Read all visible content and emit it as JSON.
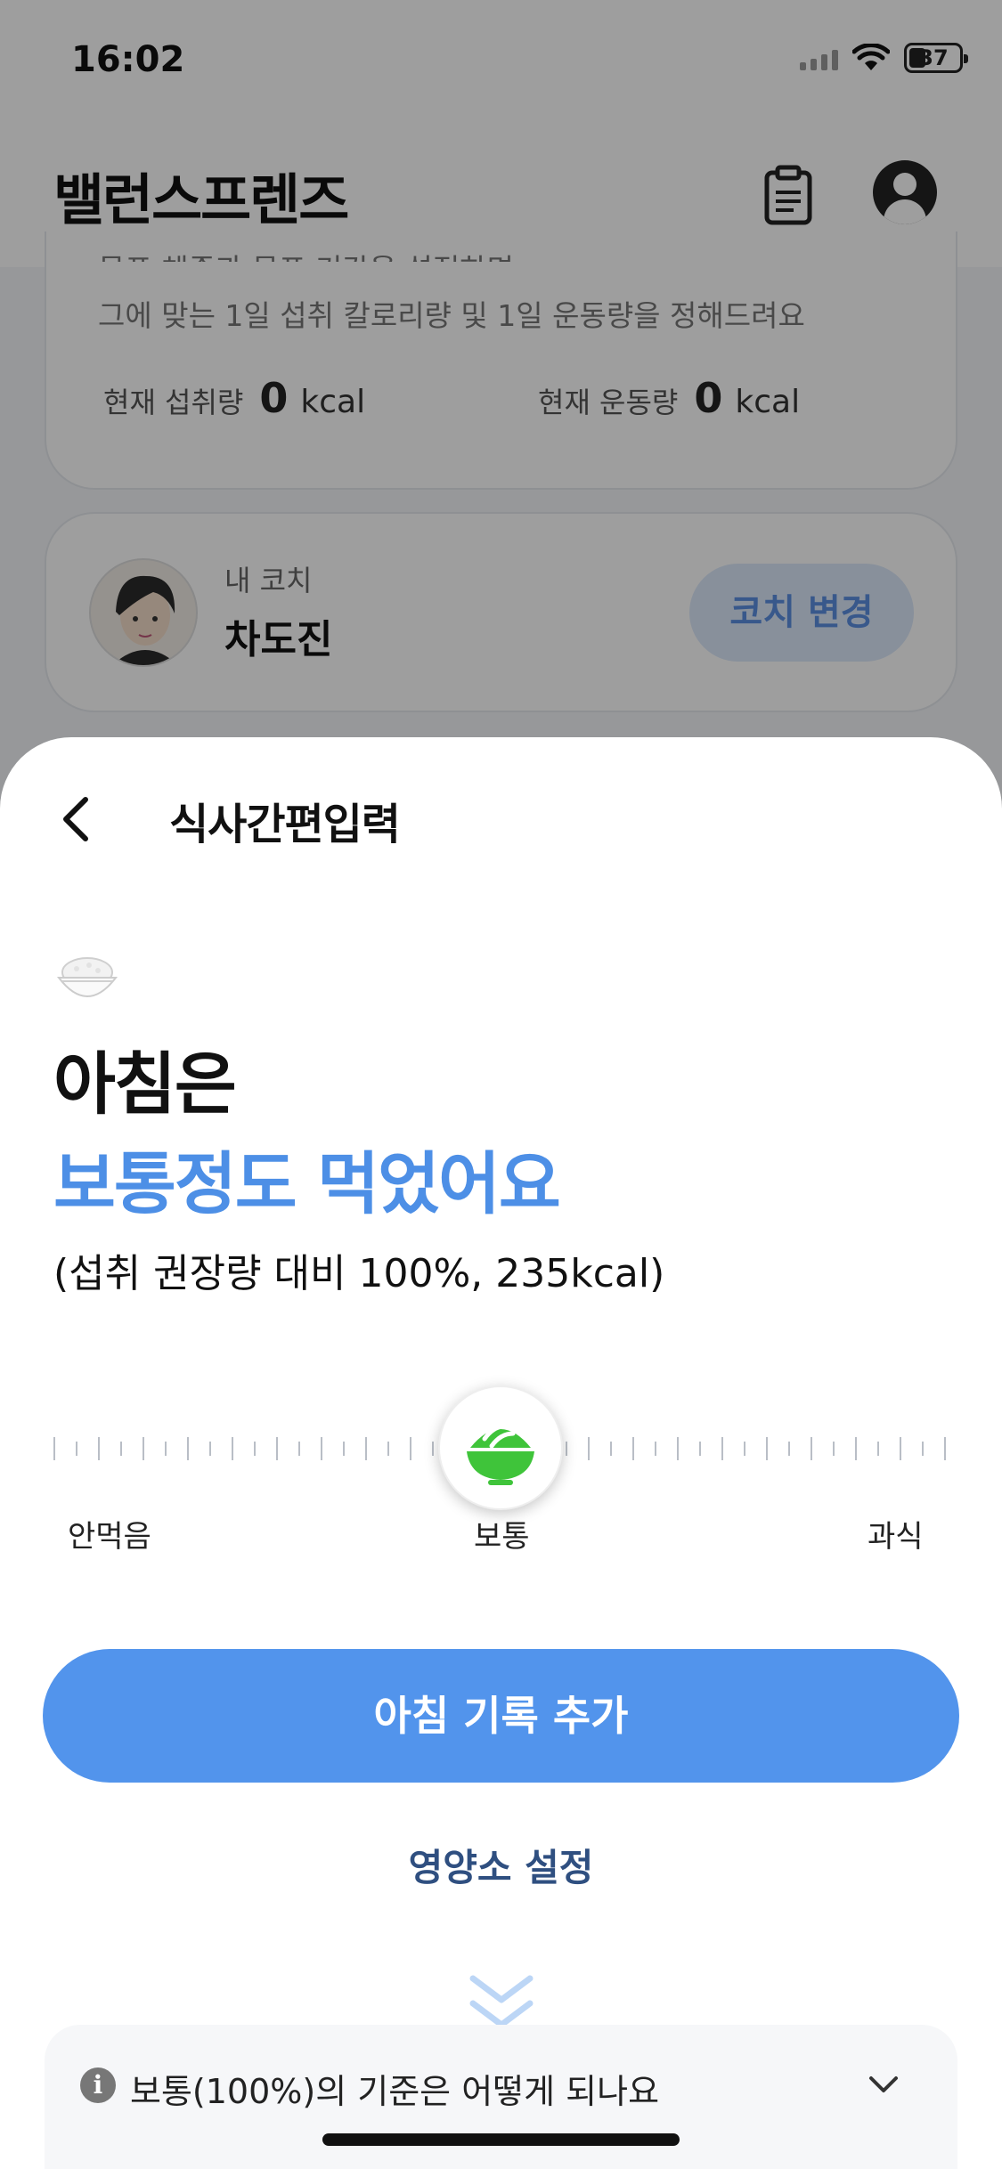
{
  "status_bar": {
    "time": "16:02",
    "battery": "37"
  },
  "header": {
    "title": "밸런스프렌즈"
  },
  "goal_card": {
    "partial_text": "목표 체중과 목표 기간을 설정하면",
    "description": "그에 맞는 1일 섭취 칼로리량 및 1일 운동량을 정해드려요",
    "intake_label": "현재 섭취량",
    "intake_value": "0",
    "intake_unit": "kcal",
    "exercise_label": "현재 운동량",
    "exercise_value": "0",
    "exercise_unit": "kcal"
  },
  "coach_card": {
    "label": "내 코치",
    "name": "차도진",
    "change_button": "코치 변경"
  },
  "sheet": {
    "title": "식사간편입력",
    "meal_title": "아침은",
    "meal_amount": "보통정도 먹었어요",
    "meal_detail": "(섭취 권장량 대비 100%, 235kcal)",
    "slider": {
      "min_label": "안먹음",
      "mid_label": "보통",
      "max_label": "과식",
      "value_percent": 50,
      "accent_color": "#3fc43a"
    },
    "add_button": "아침 기록 추가",
    "nutrient_link": "영양소 설정",
    "faq_text": "보통(100%)의 기준은 어떻게 되나요"
  },
  "colors": {
    "primary": "#5294ec",
    "accent_text": "#4d8fe6",
    "link": "#2f4f80"
  }
}
